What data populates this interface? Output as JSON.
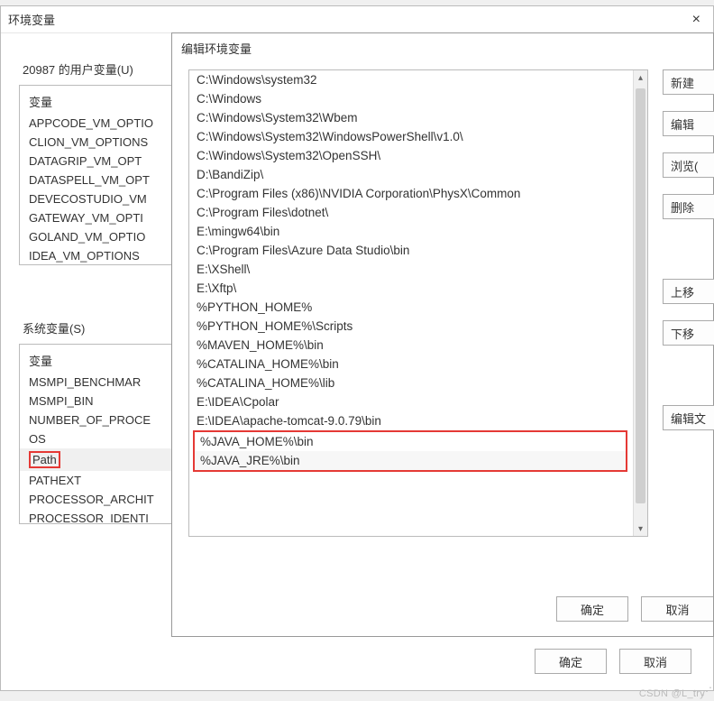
{
  "parent": {
    "title": "环境变量",
    "close": "×",
    "user_section_label": "20987 的用户变量(U)",
    "user_header": "变量",
    "user_vars": [
      "APPCODE_VM_OPTIO",
      "CLION_VM_OPTIONS",
      "DATAGRIP_VM_OPT",
      "DATASPELL_VM_OPT",
      "DEVECOSTUDIO_VM",
      "GATEWAY_VM_OPTI",
      "GOLAND_VM_OPTIO",
      "IDEA_VM_OPTIONS"
    ],
    "sys_section_label": "系统变量(S)",
    "sys_header": "变量",
    "sys_vars": [
      "MSMPI_BENCHMAR",
      "MSMPI_BIN",
      "NUMBER_OF_PROCE",
      "OS",
      "Path",
      "PATHEXT",
      "PROCESSOR_ARCHIT",
      "PROCESSOR_IDENTI"
    ],
    "sys_selected_index": 4,
    "ok": "确定",
    "cancel": "取消"
  },
  "child": {
    "title": "编辑环境变量",
    "path_entries": [
      "C:\\Windows\\system32",
      "C:\\Windows",
      "C:\\Windows\\System32\\Wbem",
      "C:\\Windows\\System32\\WindowsPowerShell\\v1.0\\",
      "C:\\Windows\\System32\\OpenSSH\\",
      "D:\\BandiZip\\",
      "C:\\Program Files (x86)\\NVIDIA Corporation\\PhysX\\Common",
      "C:\\Program Files\\dotnet\\",
      "E:\\mingw64\\bin",
      "C:\\Program Files\\Azure Data Studio\\bin",
      "E:\\XShell\\",
      "E:\\Xftp\\",
      "%PYTHON_HOME%",
      "%PYTHON_HOME%\\Scripts",
      "%MAVEN_HOME%\\bin",
      "%CATALINA_HOME%\\bin",
      "%CATALINA_HOME%\\lib",
      "E:\\IDEA\\Cpolar",
      "E:\\IDEA\\apache-tomcat-9.0.79\\bin",
      "%JAVA_HOME%\\bin",
      "%JAVA_JRE%\\bin"
    ],
    "highlight_start": 19,
    "buttons": {
      "new": "新建",
      "edit": "编辑",
      "browse": "浏览(",
      "delete": "删除",
      "up": "上移",
      "down": "下移",
      "edit_text": "编辑文"
    },
    "ok": "确定",
    "cancel": "取消"
  },
  "watermark": "CSDN @L_try"
}
